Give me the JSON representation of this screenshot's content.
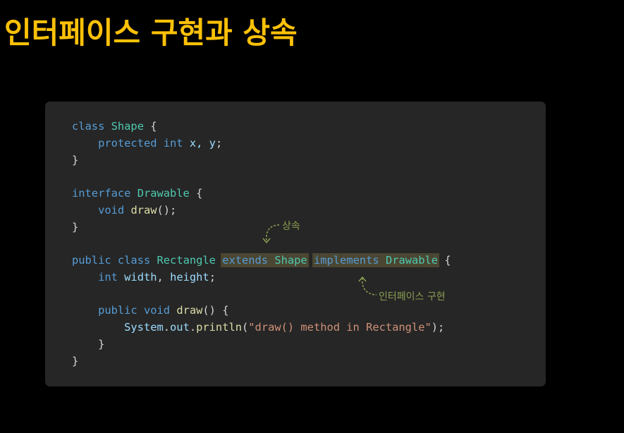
{
  "slide": {
    "title": "인터페이스 구현과 상속"
  },
  "annotations": {
    "inheritance_label": "상속",
    "interface_label": "인터페이스 구현"
  },
  "colors": {
    "title": "#ffc107",
    "background": "#000000",
    "panel": "#262626",
    "keyword": "#569cd6",
    "type": "#4ec9b0",
    "identifier": "#9cdcfe",
    "function": "#dcdcaa",
    "string": "#ce9178",
    "highlight": "#4a4632",
    "annotation": "#8a9e52"
  },
  "code": {
    "l1": {
      "kw_class": "class",
      "type_shape": "Shape",
      "brace_open": "{"
    },
    "l2": {
      "kw_protected": "protected",
      "kw_int": "int",
      "vars": "x, y",
      "semi": ";"
    },
    "l3": {
      "brace_close": "}"
    },
    "l5": {
      "kw_interface": "interface",
      "type_drawable": "Drawable",
      "brace_open": "{"
    },
    "l6": {
      "kw_void": "void",
      "fn_draw": "draw",
      "rest": "();"
    },
    "l7": {
      "brace_close": "}"
    },
    "l9": {
      "kw_public": "public",
      "kw_class": "class",
      "type_rectangle": "Rectangle",
      "kw_extends": "extends",
      "type_shape": "Shape",
      "kw_implements": "implements",
      "type_drawable": "Drawable",
      "brace_open": "{"
    },
    "l10": {
      "kw_int": "int",
      "var_width": "width",
      "comma": ",",
      "var_height": "height",
      "semi": ";"
    },
    "l12": {
      "kw_public": "public",
      "kw_void": "void",
      "fn_draw": "draw",
      "rest": "() {"
    },
    "l13": {
      "id_system": "System",
      "dot1": ".",
      "id_out": "out",
      "dot2": ".",
      "fn_println": "println",
      "paren_open": "(",
      "str_msg": "\"draw() method in Rectangle\"",
      "paren_close": ");"
    },
    "l14": {
      "brace_close": "}"
    },
    "l15": {
      "brace_close": "}"
    }
  }
}
